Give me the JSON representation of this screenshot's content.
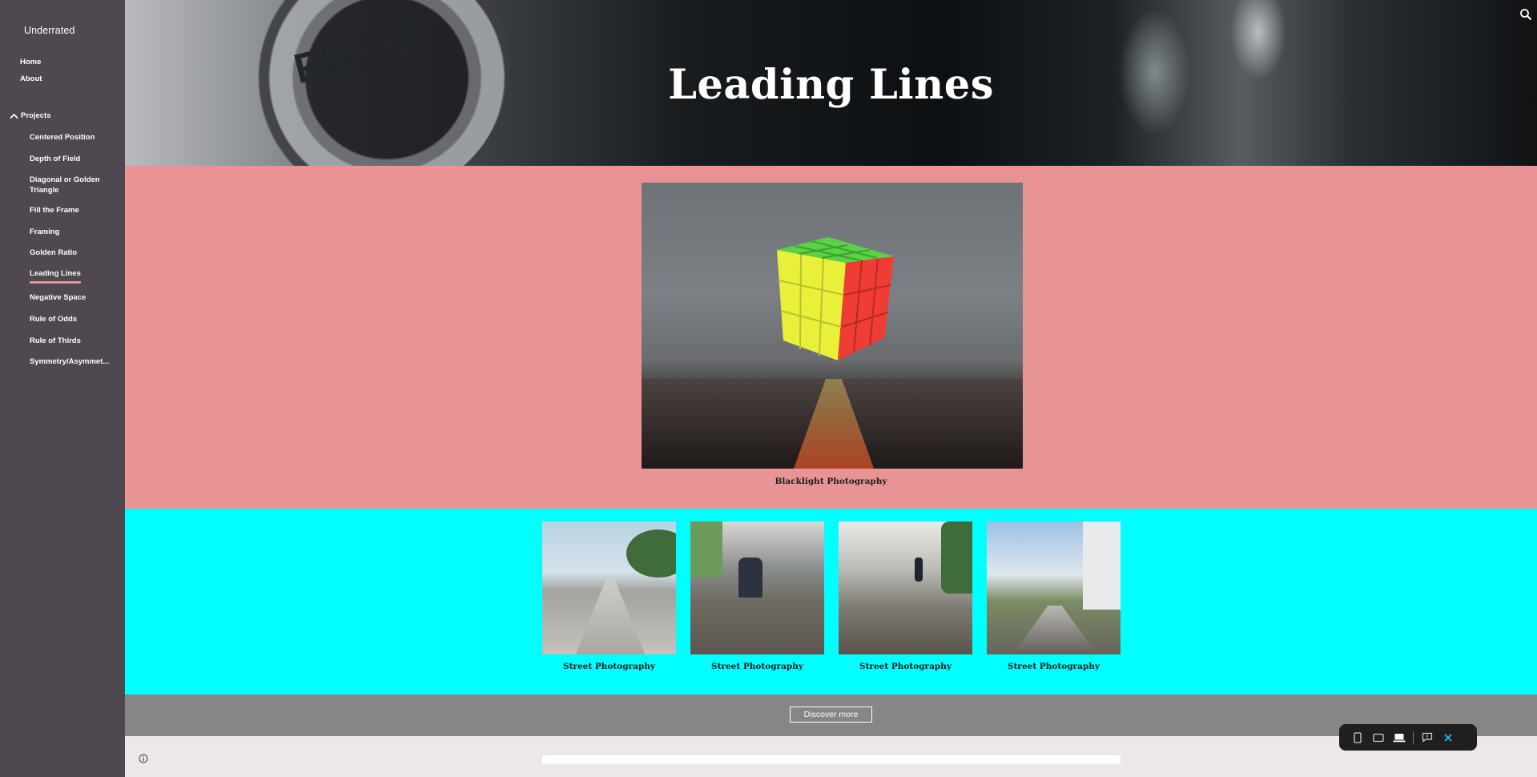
{
  "site": {
    "title": "Underrated"
  },
  "nav": {
    "home": "Home",
    "about": "About",
    "projects": "Projects",
    "items": [
      "Centered Position",
      "Depth of Field",
      "Diagonal or Golden Triangle",
      "Fill the Frame",
      "Framing",
      "Golden Ratio",
      "Leading Lines",
      "Negative Space",
      "Rule of Odds",
      "Rule of Thirds",
      "Symmetry/Asymmet..."
    ],
    "active": "Leading Lines"
  },
  "hero": {
    "title": "Leading Lines",
    "brand_text": "FUJIF"
  },
  "featured": {
    "caption": "Blacklight Photography"
  },
  "gallery": {
    "captions": [
      "Street Photography",
      "Street Photography",
      "Street Photography",
      "Street Photography"
    ]
  },
  "actions": {
    "discover_label": "Discover more"
  },
  "colors": {
    "sidebar": "#4f4851",
    "pink_section": "#e89495",
    "cyan_section": "#00ffff",
    "gray_strip": "#888587",
    "active_underline": "#e99496"
  },
  "icons": {
    "search": "search-icon",
    "info": "info-icon",
    "toolbar": [
      "phone-icon",
      "tablet-icon",
      "laptop-icon",
      "feedback-icon",
      "close-icon"
    ]
  }
}
